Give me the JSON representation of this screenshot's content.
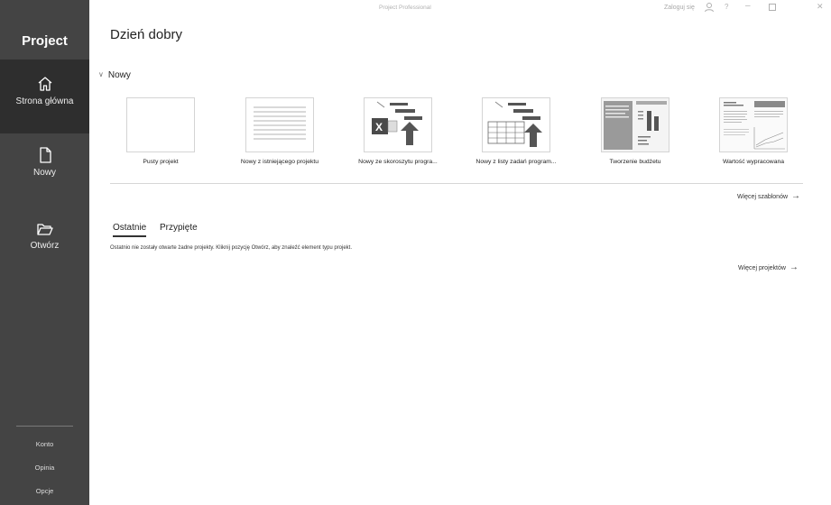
{
  "app": {
    "name": "Project",
    "window_title": "Project Professional"
  },
  "titlebar": {
    "sign_in": "Zaloguj się"
  },
  "sidebar": {
    "items": [
      {
        "label": "Strona główna",
        "icon": "home-icon"
      },
      {
        "label": "Nowy",
        "icon": "new-document-icon"
      },
      {
        "label": "Otwórz",
        "icon": "folder-open-icon"
      }
    ],
    "bottom": [
      "Konto",
      "Opinia",
      "Opcje"
    ]
  },
  "main": {
    "greeting": "Dzień dobry",
    "new_section": "Nowy",
    "templates": [
      {
        "label": "Pusty projekt"
      },
      {
        "label": "Nowy z istniejącego projektu"
      },
      {
        "label": "Nowy ze skoroszytu progra..."
      },
      {
        "label": "Nowy z listy zadań program..."
      },
      {
        "label": "Tworzenie budżetu"
      },
      {
        "label": "Wartość wypracowana"
      }
    ],
    "more_templates": "Więcej szablonów",
    "tabs": [
      "Ostatnie",
      "Przypięte"
    ],
    "empty_message": "Ostatnio nie zostały otwarte żadne projekty. Kliknij pozycję Otwórz, aby znaleźć element typu projekt.",
    "more_projects": "Więcej projektów",
    "arrow": "→"
  }
}
